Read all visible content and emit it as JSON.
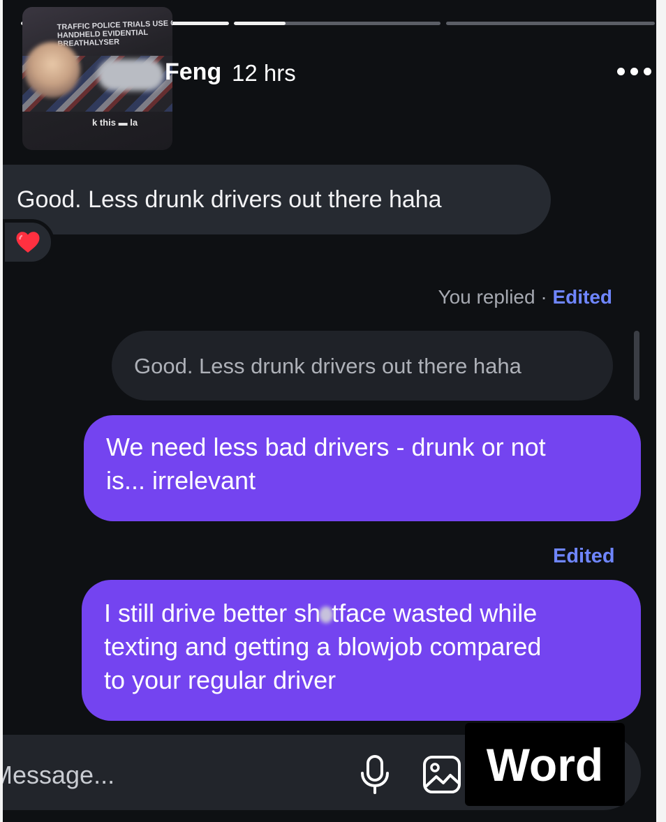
{
  "story": {
    "progress": [
      1.0,
      0.25,
      0.0
    ],
    "headline": "TRAFFIC POLICE TRIALS USE OF HANDHELD EVIDENTIAL BREATHALYSER",
    "caption_left": "k this",
    "caption_right": "la"
  },
  "header": {
    "name": "Feng",
    "time": "12 hrs",
    "more_icon": "more-horizontal-icon"
  },
  "messages": {
    "received": {
      "text": "Good. Less drunk drivers out there haha",
      "reaction": "❤️",
      "reaction_color": "#ff3040"
    },
    "reply_meta": {
      "label": "You replied · ",
      "edited": "Edited"
    },
    "quoted": "Good. Less drunk drivers out there haha",
    "sent_1": {
      "line1": "We need less bad drivers - drunk or not",
      "line2": "is... irrelevant"
    },
    "edited_2": "Edited",
    "sent_2": {
      "line1_a": "I still drive better sh",
      "line1_b": "tface wasted while",
      "line2": "texting and getting a blowjob compared",
      "line3": "to your regular driver"
    }
  },
  "composer": {
    "placeholder": "Message...",
    "mic_icon": "microphone-icon",
    "gallery_icon": "image-icon"
  },
  "watermark": "Word",
  "colors": {
    "background": "#0e1013",
    "received_bubble": "#262a31",
    "sent_bubble": "#7444f0",
    "edited_link": "#6f86ff"
  }
}
